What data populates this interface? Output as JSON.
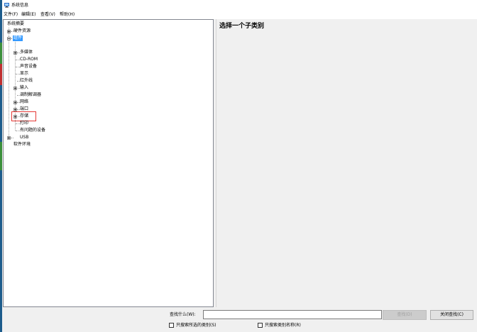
{
  "window": {
    "title": "系统信息",
    "icon": "system-info-icon"
  },
  "menubar": {
    "items": [
      "文件(F)",
      "编辑(E)",
      "查看(V)",
      "帮助(H)"
    ]
  },
  "tree": {
    "root": "系统摘要",
    "nodes": [
      {
        "label": "硬件资源",
        "expander": "plus"
      },
      {
        "label": "组件",
        "expander": "minus",
        "selected": true
      },
      {
        "label": "多媒体",
        "expander": "plus"
      },
      {
        "label": "CD-ROM",
        "expander": null
      },
      {
        "label": "声音设备",
        "expander": null
      },
      {
        "label": "显示",
        "expander": null
      },
      {
        "label": "红外线",
        "expander": null
      },
      {
        "label": "输入",
        "expander": "plus"
      },
      {
        "label": "调制解调器",
        "expander": null
      },
      {
        "label": "网络",
        "expander": "plus"
      },
      {
        "label": "端口",
        "expander": "plus"
      },
      {
        "label": "存储",
        "expander": "plus",
        "highlighted": true
      },
      {
        "label": "打印",
        "expander": null
      },
      {
        "label": "有问题的设备",
        "expander": null
      },
      {
        "label": "USB",
        "expander": null
      },
      {
        "label": "软件环境",
        "expander": "plus"
      }
    ]
  },
  "detail": {
    "heading": "选择一个子类别"
  },
  "find": {
    "label": "查找什么(W):",
    "value": "",
    "find_button": "查找(D)",
    "close_button": "关闭查找(C)",
    "check_selected_category": "只搜索所选的类别(S)",
    "check_category_names": "只搜索类别名称(R)"
  },
  "colors": {
    "selection": "#3399ff",
    "highlight_box": "#e53935",
    "window_background": "#f0f0f0"
  }
}
